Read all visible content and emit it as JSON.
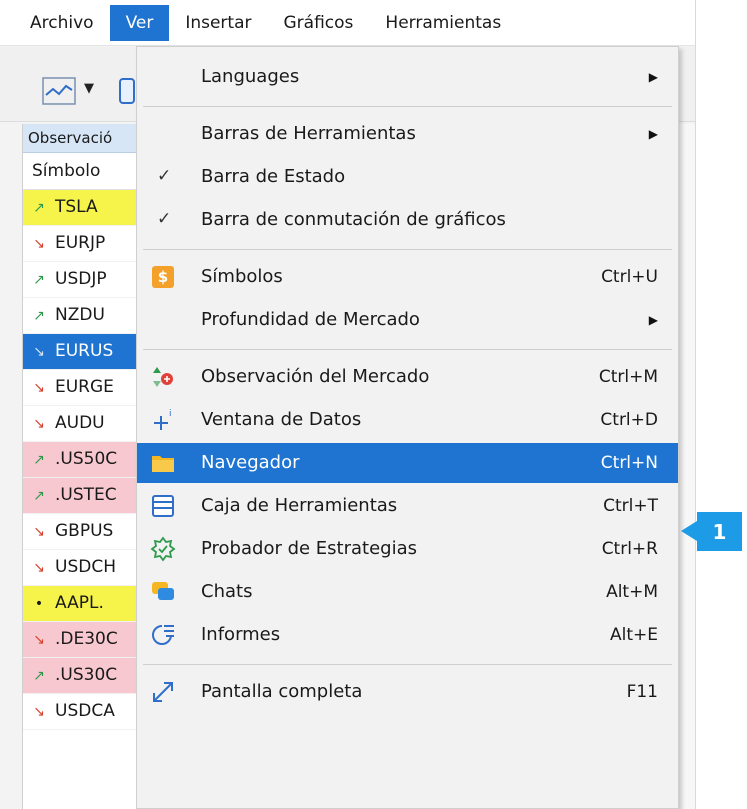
{
  "menubar": {
    "items": [
      {
        "label": "Archivo"
      },
      {
        "label": "Ver"
      },
      {
        "label": "Insertar"
      },
      {
        "label": "Gráficos"
      },
      {
        "label": "Herramientas"
      }
    ],
    "active": "Ver"
  },
  "panel": {
    "title": "Observació",
    "column_header": "Símbolo",
    "rows": [
      {
        "symbol": "TSLA",
        "trend": "up",
        "highlight": "yellow"
      },
      {
        "symbol": "EURJP",
        "trend": "down",
        "highlight": "none"
      },
      {
        "symbol": "USDJP",
        "trend": "up",
        "highlight": "none"
      },
      {
        "symbol": "NZDU",
        "trend": "up",
        "highlight": "none"
      },
      {
        "symbol": "EURUS",
        "trend": "down",
        "highlight": "blue"
      },
      {
        "symbol": "EURGE",
        "trend": "down",
        "highlight": "none"
      },
      {
        "symbol": "AUDU",
        "trend": "down",
        "highlight": "none"
      },
      {
        "symbol": ".US50C",
        "trend": "up",
        "highlight": "pink"
      },
      {
        "symbol": ".USTEC",
        "trend": "up",
        "highlight": "pink"
      },
      {
        "symbol": "GBPUS",
        "trend": "down",
        "highlight": "none"
      },
      {
        "symbol": "USDCH",
        "trend": "down",
        "highlight": "none"
      },
      {
        "symbol": "AAPL.",
        "trend": "flat",
        "highlight": "yellow"
      },
      {
        "symbol": ".DE30C",
        "trend": "down",
        "highlight": "pink"
      },
      {
        "symbol": ".US30C",
        "trend": "up",
        "highlight": "pink"
      },
      {
        "symbol": "USDCA",
        "trend": "down",
        "highlight": "none"
      }
    ]
  },
  "dropdown": {
    "items": [
      {
        "label": "Languages",
        "shortcut": "",
        "submenu": true,
        "checked": false,
        "icon": ""
      },
      {
        "separator": true
      },
      {
        "label": "Barras de Herramientas",
        "shortcut": "",
        "submenu": true,
        "checked": false,
        "icon": ""
      },
      {
        "label": "Barra de Estado",
        "shortcut": "",
        "submenu": false,
        "checked": true,
        "icon": ""
      },
      {
        "label": "Barra de conmutación de gráficos",
        "shortcut": "",
        "submenu": false,
        "checked": true,
        "icon": ""
      },
      {
        "separator": true
      },
      {
        "label": "Símbolos",
        "shortcut": "Ctrl+U",
        "submenu": false,
        "checked": false,
        "icon": "dollar-icon"
      },
      {
        "label": "Profundidad de Mercado",
        "shortcut": "",
        "submenu": true,
        "checked": false,
        "icon": ""
      },
      {
        "separator": true
      },
      {
        "label": "Observación del Mercado",
        "shortcut": "Ctrl+M",
        "submenu": false,
        "checked": false,
        "icon": "market-watch-icon"
      },
      {
        "label": "Ventana de Datos",
        "shortcut": "Ctrl+D",
        "submenu": false,
        "checked": false,
        "icon": "crosshair-icon"
      },
      {
        "label": "Navegador",
        "shortcut": "Ctrl+N",
        "submenu": false,
        "checked": false,
        "icon": "folder-icon",
        "selected": true
      },
      {
        "label": "Caja de Herramientas",
        "shortcut": "Ctrl+T",
        "submenu": false,
        "checked": false,
        "icon": "toolbox-icon"
      },
      {
        "label": "Probador de Estrategias",
        "shortcut": "Ctrl+R",
        "submenu": false,
        "checked": false,
        "icon": "strategy-tester-icon"
      },
      {
        "label": "Chats",
        "shortcut": "Alt+M",
        "submenu": false,
        "checked": false,
        "icon": "chat-icon"
      },
      {
        "label": "Informes",
        "shortcut": "Alt+E",
        "submenu": false,
        "checked": false,
        "icon": "reports-icon"
      },
      {
        "separator": true
      },
      {
        "label": "Pantalla completa",
        "shortcut": "F11",
        "submenu": false,
        "checked": false,
        "icon": "fullscreen-icon"
      }
    ]
  },
  "callout": {
    "label": "1"
  },
  "colors": {
    "accent": "#1e74d0",
    "callout": "#1e9be6",
    "row_yellow": "#f6f34a",
    "row_pink": "#f7c8cf",
    "trend_up": "#2e9a4c",
    "trend_down": "#d9402b"
  }
}
